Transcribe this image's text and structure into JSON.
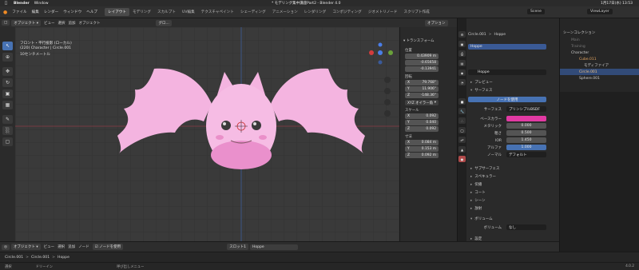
{
  "mac": {
    "app": "Blender",
    "window_menu": "Window",
    "title": "* モデリング集中講座Part2 - Blender 4.0",
    "clock": "1月17日(水) 13:53"
  },
  "menu": [
    "ファイル",
    "編集",
    "レンダー",
    "ウィンドウ",
    "ヘルプ"
  ],
  "workspaces": [
    "レイアウト",
    "モデリング",
    "スカルプト",
    "UV編集",
    "テクスチャペイント",
    "シェーディング",
    "アニメーション",
    "レンダリング",
    "コンポジティング",
    "ジオメトリノード",
    "スクリプト作成"
  ],
  "active_workspace": "レイアウト",
  "scene": "Scene",
  "viewlayer": "ViewLayer",
  "viewport_header": {
    "mode": "オブジェクト",
    "items": [
      "ビュー",
      "選択",
      "追加",
      "オブジェクト"
    ],
    "transform_orient": "グロ...",
    "options": "オプション"
  },
  "overlay": {
    "line1": "フロント・平行投影 (ローカル)",
    "line2": "(220) Character | Circle.001",
    "line3": "10センチメートル"
  },
  "npanel": {
    "section": "トランスフォーム",
    "location_label": "位置",
    "location": [
      "0.43909 m",
      "-0.65658",
      "-0.13941"
    ],
    "rotation_label": "回転",
    "rotation": [
      {
        "axis": "X",
        "value": "79.768°"
      },
      {
        "axis": "Y",
        "value": "11.906°"
      },
      {
        "axis": "Z",
        "value": "-148.36°"
      }
    ],
    "rotation_mode": "XYZ オイラー角",
    "scale_label": "スケール",
    "scale": [
      {
        "axis": "X",
        "value": "0.092"
      },
      {
        "axis": "Y",
        "value": "0.040"
      },
      {
        "axis": "Z",
        "value": "0.092"
      }
    ],
    "dimensions_label": "寸法",
    "dimensions": [
      {
        "axis": "X",
        "value": "0.084 m"
      },
      {
        "axis": "Y",
        "value": "0.153 m"
      },
      {
        "axis": "Z",
        "value": "0.092 m"
      }
    ]
  },
  "outliner": {
    "title": "シーンコレクション",
    "rows": [
      "Main",
      "Training",
      "Character",
      "Cube.011",
      "モディファイア",
      "Circle.001",
      "Sphere.001"
    ]
  },
  "properties": {
    "object": "Circle.001",
    "material_path": "Hoppe",
    "material_slot": "Hoppe",
    "material_name": "Hoppe",
    "preview": "プレビュー",
    "surface": "サーフェス",
    "use_nodes": "ノードを使用",
    "surface_label": "サーフェス",
    "shader": "プリンシプルBSDF",
    "fields": [
      {
        "label": "ベースカラー",
        "value": ""
      },
      {
        "label": "メタリック",
        "value": "0.000"
      },
      {
        "label": "粗さ",
        "value": "0.500"
      },
      {
        "label": "IOR",
        "value": "1.450"
      },
      {
        "label": "アルファ",
        "value": "1.000"
      },
      {
        "label": "ノーマル",
        "value": "デフォルト"
      }
    ],
    "subsections": [
      "サブサーフェス",
      "スペキュラー",
      "伝播",
      "コート",
      "シーン",
      "放射"
    ],
    "volume": "ボリューム",
    "volume_label": "ボリューム",
    "volume_value": "なし",
    "settings": "設定",
    "base_color_hex": "#e23aa3"
  },
  "shading_header": {
    "mode": "オブジェクト",
    "items": [
      "ビュー",
      "選択",
      "追加",
      "ノード"
    ],
    "use_nodes": "ノードを使用",
    "slot": "スロット1",
    "material": "Hoppe"
  },
  "breadcrumb": [
    "Circle.001",
    "Circle.001",
    "Hoppe"
  ],
  "node_panel": "ノード",
  "status": {
    "select": "選択",
    "pan": "ドリーイン",
    "menu": "呼び出しメニュー",
    "version": "4.0.2"
  },
  "colors": {
    "accent": "#4772b3",
    "character_pink": "#f4b4e0"
  }
}
